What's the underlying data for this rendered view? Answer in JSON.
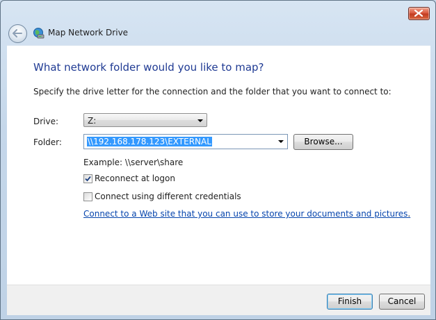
{
  "window": {
    "title": "Map Network Drive",
    "icons": {
      "close": "close-icon",
      "back": "back-arrow-icon",
      "title": "network-drive-icon"
    }
  },
  "content": {
    "heading": "What network folder would you like to map?",
    "instruction": "Specify the drive letter for the connection and the folder that you want to connect to:",
    "drive": {
      "label": "Drive:",
      "value": "Z:"
    },
    "folder": {
      "label": "Folder:",
      "value": "\\\\192.168.178.123\\EXTERNAL",
      "browse_label": "Browse..."
    },
    "example": "Example: \\\\server\\share",
    "reconnect": {
      "label": "Reconnect at logon",
      "checked": true
    },
    "credentials": {
      "label": "Connect using different credentials",
      "checked": false
    },
    "web_link": "Connect to a Web site that you can use to store your documents and pictures",
    "web_link_suffix": "."
  },
  "footer": {
    "finish_label": "Finish",
    "cancel_label": "Cancel"
  },
  "colors": {
    "heading": "#1f3a93",
    "link": "#0645ad",
    "selection": "#3399ff",
    "close_button": "#c13a20"
  }
}
